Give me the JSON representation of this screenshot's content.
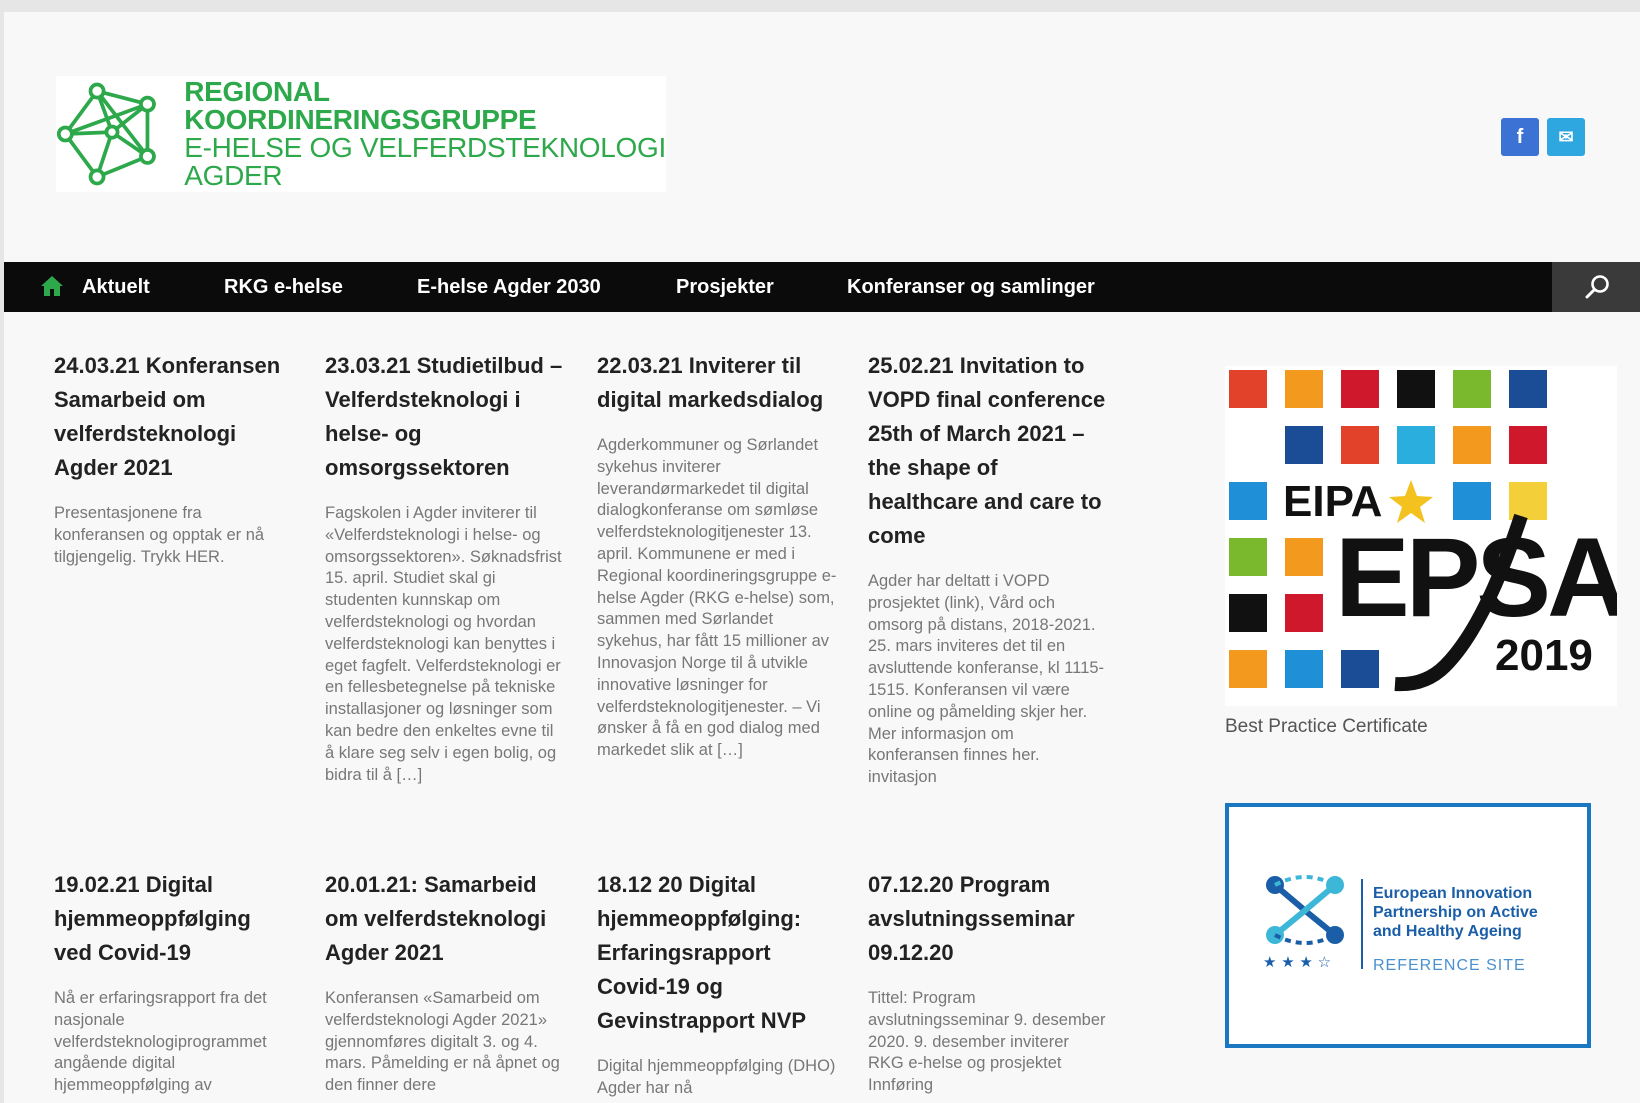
{
  "header": {
    "logo_lines": [
      "REGIONAL",
      "KOORDINERINGSGRUPPE",
      "E-HELSE OG VELFERDSTEKNOLOGI",
      "AGDER"
    ],
    "social": [
      {
        "icon": "facebook-icon",
        "glyph": "f"
      },
      {
        "icon": "mail-icon",
        "glyph": "✉"
      }
    ]
  },
  "nav": {
    "items": [
      "Aktuelt",
      "RKG e-helse",
      "E-helse Agder 2030",
      "Prosjekter",
      "Konferanser og samlinger"
    ],
    "home_icon": "home-icon",
    "search_icon": "search-icon"
  },
  "posts": [
    {
      "title": "24.03.21 Konferansen Samarbeid om velferdsteknologi Agder 2021",
      "excerpt": "Presentasjonene fra konferansen og opptak er nå tilgjengelig. Trykk HER."
    },
    {
      "title": "23.03.21 Studietilbud – Velferdsteknologi i helse- og omsorgssektoren",
      "excerpt": "Fagskolen i Agder inviterer til «Velferdsteknologi i helse- og omsorgssektoren». Søknadsfrist 15. april. Studiet skal gi studenten kunnskap om velferdsteknologi og hvordan velferdsteknologi kan benyttes i eget fagfelt. Velferdsteknologi er en fellesbetegnelse på tekniske installasjoner og løsninger som kan bedre den enkeltes evne til å klare seg selv i egen bolig, og bidra til å […]"
    },
    {
      "title": "22.03.21 Inviterer til digital markedsdialog",
      "excerpt": "Agderkommuner og Sørlandet sykehus inviterer leverandørmarkedet til digital dialogkonferanse om sømløse velferdsteknologitjenester 13. april. Kommunene er med i Regional koordineringsgruppe e-helse Agder (RKG e-helse) som, sammen med Sørlandet sykehus, har fått 15 millioner av Innovasjon Norge til å utvikle innovative løsninger for velferdsteknologitjenester. – Vi ønsker å få en god dialog med markedet slik at […]"
    },
    {
      "title": "25.02.21 Invitation to VOPD final conference 25th of March 2021 – the shape of healthcare and care to come",
      "excerpt": "Agder har deltatt i VOPD prosjektet (link), Vård och omsorg på distans, 2018-2021. 25. mars inviteres det til en avsluttende konferanse, kl 1115-1515. Konferansen vil være online og påmelding skjer her. Mer informasjon om konferansen finnes her. invitasjon"
    },
    {
      "title": "19.02.21 Digital hjemmeoppfølging ved Covid-19",
      "excerpt": "Nå er erfaringsrapport fra det nasjonale velferdsteknologiprogrammet angående digital hjemmeoppfølging av"
    },
    {
      "title": "20.01.21: Samarbeid om velferdsteknologi Agder 2021",
      "excerpt": "Konferansen «Samarbeid om velferdsteknologi Agder 2021» gjennomføres digitalt 3. og 4. mars.  Påmelding er nå åpnet og den finner dere"
    },
    {
      "title": "18.12 20 Digital hjemmeoppfølging: Erfaringsrapport Covid-19 og Gevinstrapport NVP",
      "excerpt": "Digital hjemmeoppfølging (DHO) Agder har nå"
    },
    {
      "title": "07.12.20 Program avslutningsseminar 09.12.20",
      "excerpt": "Tittel: Program avslutningsseminar 9. desember 2020. 9. desember inviterer RKG e-helse og prosjektet Innføring"
    }
  ],
  "sidebar": {
    "eipa_left": "EIPA",
    "eipa_big": "EPSA",
    "eipa_year": "2019",
    "cert_caption": "Best Practice Certificate",
    "eip_lines": [
      "European Innovation",
      "Partnership on Active",
      "and Healthy Ageing"
    ],
    "eip_ref": "REFERENCE SITE",
    "eip_stars": "★ ★ ★ ☆"
  },
  "colors": {
    "brand_green": "#2da84a",
    "nav_bg": "#0b0b0b",
    "facebook": "#3b72d4",
    "mail": "#2ea6e0",
    "eip_blue": "#1a78c2"
  }
}
